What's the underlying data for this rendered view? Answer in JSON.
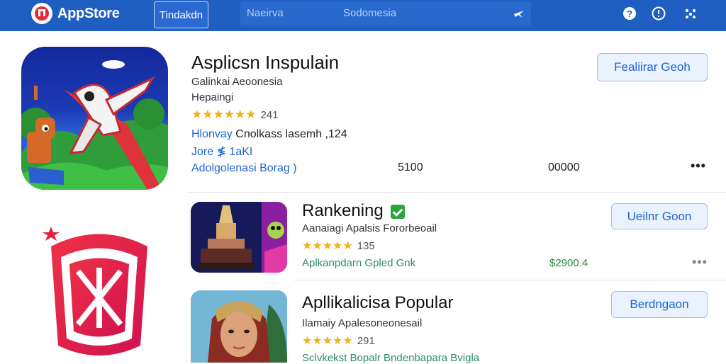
{
  "header": {
    "brand": "AppStore",
    "tab_label": "Tindakdn",
    "search_name": "Naeirva",
    "search_region": "Sodomesia"
  },
  "featured": {
    "title": "Asplicsn Inspulain",
    "subtitle1": "Galinkai Aeoonesia",
    "subtitle2": "Hepaingi",
    "stars": "★★★★★★",
    "rating": "241",
    "meta1_blue": "Hlonvay",
    "meta1_rest": " Cnolkass lasemh ,124",
    "meta2": "Jore ≸ 1aKI",
    "link": "Adolgolenasi Borag )",
    "count1": "5100",
    "count2": "00000",
    "button": "Fealiirar Geoh",
    "more": "•••"
  },
  "rows": [
    {
      "title": "Rankening",
      "subtitle": "Aanaiagi Apalsis Fororbeoail",
      "stars": "★★★★★",
      "rating": "135",
      "meta": "Aplkanpdarn Gpled Gnk",
      "price": "$2900.4",
      "button": "Ueilnr Goon",
      "more": "•••"
    },
    {
      "title": "Apllikalicisa Popular",
      "subtitle": "Ilamaiy Apalesoneonesail",
      "stars": "★★★★★",
      "rating": "291",
      "meta": "Sclvkekst Bopalr Bndenbapara Bvigla",
      "button": "Berdngaon"
    }
  ],
  "colors": {
    "header_bg": "#1f5fc2",
    "accent_blue": "#1d63d6",
    "star": "#f2b21b",
    "verified_green": "#2aa63b"
  }
}
